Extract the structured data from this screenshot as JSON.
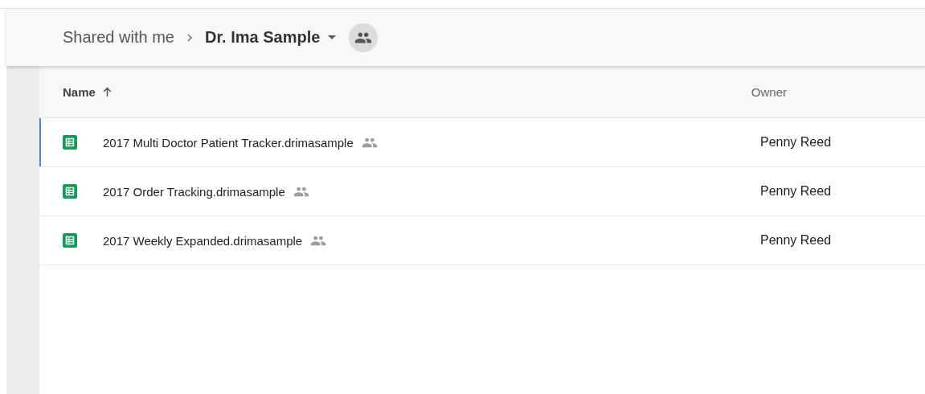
{
  "breadcrumb": {
    "parent": "Shared with me",
    "current": "Dr. Ima Sample"
  },
  "table": {
    "columns": [
      {
        "label": "Name",
        "sorted": true
      },
      {
        "label": "Owner",
        "sorted": false
      }
    ],
    "rows": [
      {
        "name": "2017 Multi Doctor Patient Tracker.drimasample",
        "shared": true,
        "owner": "Penny Reed",
        "selected": true
      },
      {
        "name": "2017 Order Tracking.drimasample",
        "shared": true,
        "owner": "Penny Reed",
        "selected": false
      },
      {
        "name": "2017 Weekly Expanded.drimasample",
        "shared": true,
        "owner": "Penny Reed",
        "selected": false
      }
    ]
  }
}
